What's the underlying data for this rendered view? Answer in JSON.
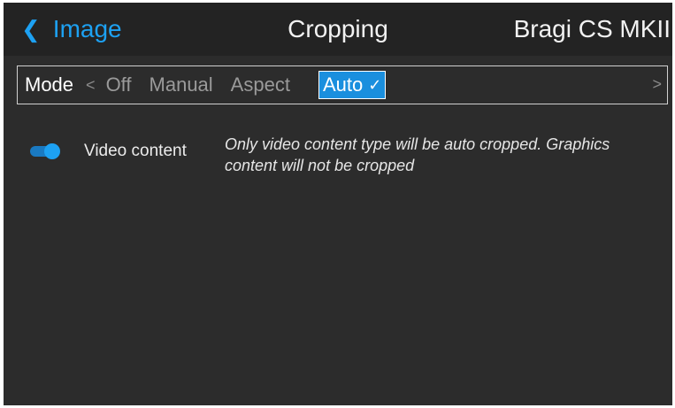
{
  "header": {
    "back_label": "Image",
    "title": "Cropping",
    "device_name": "Bragi CS MKII"
  },
  "mode_selector": {
    "label": "Mode",
    "options": [
      "Off",
      "Manual",
      "Aspect",
      "Auto"
    ],
    "selected": "Auto"
  },
  "settings": [
    {
      "label": "Video content",
      "enabled": true,
      "description": "Only video content type will be auto cropped. Graphics content will not be cropped"
    }
  ],
  "colors": {
    "accent": "#1da1f2",
    "selected_background": "#1a8fde",
    "screen_background": "#2c2c2c",
    "header_background": "#232323"
  },
  "icons": {
    "back": "chevron-left-icon",
    "prev": "chevron-left-icon",
    "next": "chevron-right-icon",
    "selected": "check-icon"
  }
}
